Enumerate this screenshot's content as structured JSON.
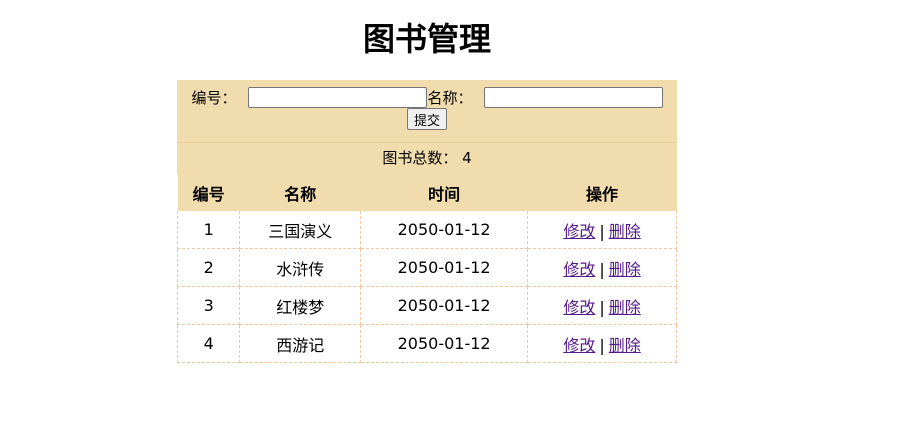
{
  "page": {
    "title": "图书管理"
  },
  "form": {
    "id_label": "编号：",
    "id_value": "",
    "name_label": "名称：",
    "name_value": "",
    "submit_label": "提交"
  },
  "summary": {
    "total_label": "图书总数：",
    "total_count": "4"
  },
  "table": {
    "columns": [
      "编号",
      "名称",
      "时间",
      "操作"
    ],
    "rows": [
      {
        "id": "1",
        "name": "三国演义",
        "time": "2050-01-12",
        "edit": "修改",
        "sep": "|",
        "delete": "删除"
      },
      {
        "id": "2",
        "name": "水浒传",
        "time": "2050-01-12",
        "edit": "修改",
        "sep": "|",
        "delete": "删除"
      },
      {
        "id": "3",
        "name": "红楼梦",
        "time": "2050-01-12",
        "edit": "修改",
        "sep": "|",
        "delete": "删除"
      },
      {
        "id": "4",
        "name": "西游记",
        "time": "2050-01-12",
        "edit": "修改",
        "sep": "|",
        "delete": "删除"
      }
    ]
  },
  "colors": {
    "panel_bg": "#f1dcae",
    "cell_border": "#f3c8a0",
    "link": "#551a8b"
  }
}
